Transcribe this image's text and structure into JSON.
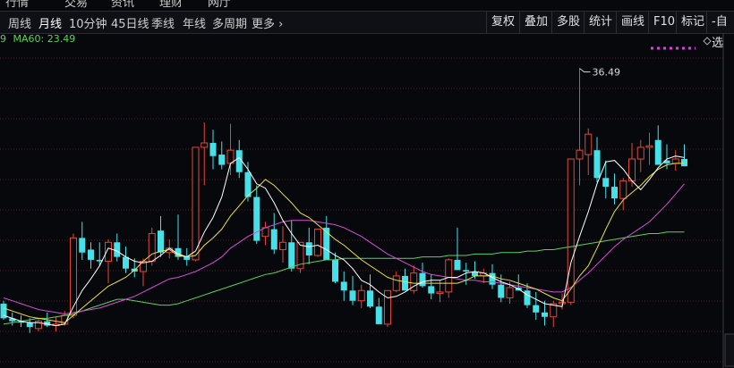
{
  "top_nav": [
    "行情",
    "交易",
    "资讯",
    "理财",
    "网厅"
  ],
  "periods": [
    {
      "label": "周线",
      "active": false
    },
    {
      "label": "月线",
      "active": true
    },
    {
      "label": "10分钟",
      "active": false
    },
    {
      "label": "45日线",
      "active": false
    },
    {
      "label": "季线",
      "active": false
    },
    {
      "label": "年线",
      "active": false
    },
    {
      "label": "多周期",
      "active": false
    },
    {
      "label": "更多",
      "active": false
    }
  ],
  "tools": [
    "复权",
    "叠加",
    "多股",
    "统计",
    "画线",
    "F10",
    "标记",
    "-自选"
  ],
  "legend": {
    "clipped_value": "9",
    "ma60_label": "MA60:",
    "ma60_value": "23.49",
    "ma60_color": "#5cd05c"
  },
  "colors": {
    "up": "#e0473a",
    "down": "#45e0e8",
    "ma5": "#ffffff",
    "ma10": "#e9e04a",
    "ma20": "#d44fd4",
    "ma60": "#5cd05c",
    "grid": "#5a1e1e",
    "background": "#07080c"
  },
  "chart_data": {
    "type": "candlestick",
    "ylim": [
      16,
      38
    ],
    "price_note": "36.49",
    "candles": [
      [
        20.4,
        20.6,
        19.3,
        19.4
      ],
      [
        19.4,
        19.8,
        18.9,
        19.2
      ],
      [
        19.2,
        19.6,
        18.8,
        19.1
      ],
      [
        19.1,
        19.4,
        18.4,
        18.8
      ],
      [
        18.7,
        19.4,
        18.5,
        19.2
      ],
      [
        19.2,
        19.8,
        18.8,
        18.9
      ],
      [
        18.9,
        19.5,
        18.5,
        19.0
      ],
      [
        19.0,
        19.9,
        18.9,
        19.6
      ],
      [
        19.6,
        25.2,
        19.4,
        24.9
      ],
      [
        24.9,
        26.0,
        23.4,
        23.9
      ],
      [
        24.1,
        24.6,
        22.8,
        23.4
      ],
      [
        23.4,
        24.6,
        23.0,
        23.3
      ],
      [
        23.3,
        24.8,
        21.8,
        24.6
      ],
      [
        24.6,
        25.2,
        23.3,
        23.6
      ],
      [
        23.6,
        24.3,
        22.5,
        22.8
      ],
      [
        22.8,
        23.5,
        22.2,
        22.6
      ],
      [
        22.6,
        23.5,
        21.6,
        23.3
      ],
      [
        23.3,
        25.6,
        23.0,
        25.2
      ],
      [
        25.4,
        26.4,
        23.6,
        23.9
      ],
      [
        23.9,
        24.8,
        23.5,
        24.2
      ],
      [
        24.2,
        26.5,
        23.4,
        23.6
      ],
      [
        23.6,
        24.2,
        23.0,
        23.4
      ],
      [
        23.4,
        26.2,
        23.3,
        31.1
      ],
      [
        31.1,
        32.8,
        28.5,
        31.4
      ],
      [
        31.4,
        32.3,
        29.6,
        30.5
      ],
      [
        30.6,
        31.5,
        29.6,
        29.9
      ],
      [
        30.0,
        32.7,
        29.2,
        30.9
      ],
      [
        30.9,
        31.6,
        29.0,
        29.4
      ],
      [
        29.4,
        30.1,
        27.4,
        27.7
      ],
      [
        27.7,
        28.5,
        24.5,
        24.7
      ],
      [
        25.0,
        26.0,
        24.4,
        25.6
      ],
      [
        25.5,
        26.6,
        23.8,
        24.1
      ],
      [
        24.1,
        25.7,
        23.2,
        24.6
      ],
      [
        24.6,
        26.1,
        22.6,
        22.8
      ],
      [
        22.8,
        24.2,
        22.5,
        24.6
      ],
      [
        24.6,
        25.6,
        23.1,
        23.7
      ],
      [
        23.7,
        25.5,
        23.6,
        25.5
      ],
      [
        25.6,
        26.4,
        23.4,
        23.4
      ],
      [
        23.4,
        23.9,
        21.8,
        21.9
      ],
      [
        21.9,
        22.6,
        20.6,
        21.3
      ],
      [
        21.3,
        22.3,
        20.3,
        20.6
      ],
      [
        20.6,
        21.7,
        20.1,
        21.3
      ],
      [
        21.3,
        22.4,
        20.1,
        20.2
      ],
      [
        20.2,
        20.8,
        19.0,
        19.0
      ],
      [
        19.0,
        21.3,
        18.8,
        21.3
      ],
      [
        21.3,
        22.6,
        21.2,
        22.3
      ],
      [
        22.3,
        22.8,
        21.3,
        21.3
      ],
      [
        21.3,
        23.0,
        21.1,
        22.5
      ],
      [
        22.5,
        23.2,
        21.5,
        21.6
      ],
      [
        21.6,
        22.4,
        20.7,
        21.1
      ],
      [
        21.1,
        22.0,
        20.5,
        21.2
      ],
      [
        21.2,
        23.5,
        20.8,
        23.4
      ],
      [
        23.4,
        25.6,
        23.2,
        22.7
      ],
      [
        22.7,
        23.2,
        21.7,
        22.6
      ],
      [
        22.6,
        23.3,
        22.1,
        22.3
      ],
      [
        22.3,
        22.8,
        21.8,
        22.5
      ],
      [
        22.5,
        23.1,
        21.4,
        21.7
      ],
      [
        21.7,
        22.4,
        20.5,
        20.8
      ],
      [
        20.8,
        21.9,
        20.4,
        21.5
      ],
      [
        21.5,
        22.4,
        21.4,
        21.3
      ],
      [
        21.3,
        21.8,
        20.1,
        20.3
      ],
      [
        20.3,
        21.2,
        19.3,
        19.8
      ],
      [
        19.8,
        20.6,
        18.9,
        19.5
      ],
      [
        19.5,
        20.6,
        18.8,
        20.4
      ],
      [
        20.4,
        21.1,
        20.0,
        20.5
      ],
      [
        20.5,
        21.4,
        20.3,
        30.3
      ],
      [
        30.3,
        36.5,
        28.5,
        30.9
      ],
      [
        30.6,
        32.4,
        29.2,
        32.0
      ],
      [
        30.9,
        31.8,
        28.7,
        29.0
      ],
      [
        29.0,
        30.2,
        27.6,
        28.4
      ],
      [
        28.4,
        29.3,
        27.2,
        27.6
      ],
      [
        27.6,
        29.0,
        26.8,
        28.8
      ],
      [
        28.8,
        31.4,
        28.4,
        30.3
      ],
      [
        30.3,
        31.6,
        29.4,
        31.1
      ],
      [
        31.1,
        32.1,
        29.9,
        31.2
      ],
      [
        31.6,
        32.6,
        30.2,
        29.9
      ],
      [
        30.2,
        31.3,
        29.6,
        30.0
      ],
      [
        30.0,
        30.9,
        29.5,
        30.3
      ],
      [
        30.3,
        31.3,
        29.8,
        29.8
      ]
    ],
    "ma5": [
      19.6,
      19.4,
      19.2,
      19.1,
      19.1,
      19.0,
      18.9,
      19.0,
      20.2,
      21.3,
      22.1,
      23.0,
      24.2,
      24.0,
      23.6,
      23.3,
      23.2,
      23.3,
      23.7,
      24.2,
      23.8,
      23.6,
      24.0,
      25.3,
      26.3,
      27.7,
      30.0,
      30.4,
      29.6,
      28.6,
      28.3,
      27.3,
      26.1,
      25.2,
      24.4,
      24.3,
      24.4,
      24.1,
      23.7,
      23.4,
      22.8,
      22.0,
      21.7,
      21.2,
      20.8,
      20.9,
      21.2,
      21.6,
      21.9,
      22.0,
      22.0,
      22.2,
      22.2,
      22.5,
      22.6,
      22.5,
      22.2,
      21.9,
      21.7,
      21.4,
      21.0,
      20.7,
      20.4,
      20.3,
      20.2,
      23.2,
      25.0,
      26.7,
      28.6,
      30.1,
      30.2,
      29.6,
      28.8,
      28.2,
      28.9,
      29.7,
      30.3,
      30.5,
      30.4
    ],
    "ma10": [
      20.1,
      19.9,
      19.7,
      19.5,
      19.4,
      19.3,
      19.2,
      19.1,
      19.6,
      20.1,
      20.6,
      21.1,
      21.6,
      21.9,
      22.2,
      22.7,
      23.3,
      23.8,
      24.0,
      24.1,
      23.7,
      23.6,
      23.7,
      24.4,
      24.9,
      25.5,
      26.4,
      27.1,
      27.8,
      28.3,
      28.9,
      28.5,
      27.9,
      27.3,
      26.6,
      26.3,
      25.8,
      25.3,
      24.8,
      24.4,
      23.9,
      23.4,
      23.0,
      22.6,
      22.2,
      22.0,
      21.9,
      21.8,
      21.8,
      21.8,
      21.8,
      21.8,
      21.8,
      22.0,
      22.3,
      22.3,
      22.3,
      22.1,
      22.0,
      21.8,
      21.6,
      21.4,
      21.1,
      20.8,
      20.6,
      21.4,
      22.3,
      23.0,
      24.2,
      25.5,
      26.7,
      27.5,
      28.0,
      28.5,
      29.1,
      29.6,
      29.9,
      30.0,
      30.0
    ],
    "ma20": [
      20.8,
      20.6,
      20.4,
      20.2,
      20.0,
      19.9,
      19.8,
      19.7,
      19.8,
      19.9,
      20.0,
      20.1,
      20.3,
      20.5,
      20.7,
      20.9,
      21.2,
      21.5,
      21.8,
      22.1,
      22.2,
      22.4,
      22.6,
      22.9,
      23.2,
      23.6,
      24.2,
      24.6,
      25.0,
      25.3,
      25.6,
      25.8,
      26.0,
      26.1,
      26.1,
      26.1,
      26.0,
      25.9,
      25.8,
      25.6,
      25.3,
      25.0,
      24.6,
      24.2,
      23.8,
      23.5,
      23.2,
      22.9,
      22.6,
      22.4,
      22.3,
      22.2,
      22.1,
      22.0,
      22.0,
      21.9,
      21.9,
      21.8,
      21.7,
      21.6,
      21.5,
      21.4,
      21.3,
      21.2,
      21.2,
      21.5,
      22.0,
      22.5,
      23.1,
      23.7,
      24.3,
      24.8,
      25.2,
      25.6,
      26.0,
      26.6,
      27.2,
      27.9,
      28.6
    ],
    "ma60": [
      19.0,
      19.1,
      19.2,
      19.3,
      19.4,
      19.4,
      19.5,
      19.6,
      19.7,
      19.9,
      20.1,
      20.3,
      20.5,
      20.7,
      20.7,
      20.6,
      20.5,
      20.4,
      20.3,
      20.3,
      20.4,
      20.6,
      20.8,
      21.0,
      21.2,
      21.4,
      21.6,
      21.8,
      22.0,
      22.2,
      22.4,
      22.5,
      22.7,
      22.9,
      23.1,
      23.2,
      23.3,
      23.4,
      23.4,
      23.5,
      23.5,
      23.5,
      23.5,
      23.5,
      23.5,
      23.5,
      23.5,
      23.5,
      23.6,
      23.6,
      23.6,
      23.7,
      23.7,
      23.7,
      23.8,
      23.8,
      23.8,
      23.9,
      23.9,
      23.9,
      24.0,
      24.0,
      24.1,
      24.1,
      24.2,
      24.3,
      24.4,
      24.5,
      24.6,
      24.7,
      24.8,
      24.9,
      25.0,
      25.1,
      25.2,
      25.2,
      25.3,
      25.3,
      25.3
    ]
  }
}
